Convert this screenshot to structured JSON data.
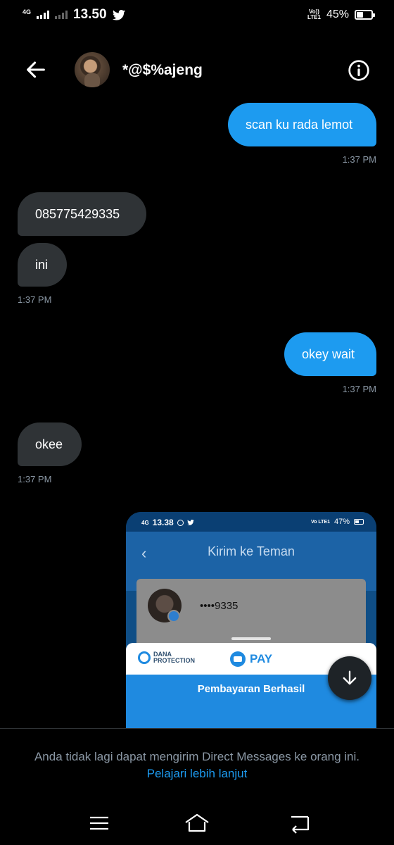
{
  "status_bar": {
    "network": "4G",
    "time": "13.50",
    "volte": [
      "Vo))",
      "LTE1"
    ],
    "battery_percent": "45%",
    "battery_level": 0.45,
    "icons": [
      "signal-icon",
      "twitter-bird-icon",
      "battery-icon"
    ]
  },
  "header": {
    "contact_name": "*@$%ajeng",
    "icons": [
      "back-arrow-icon",
      "info-icon"
    ]
  },
  "messages": [
    {
      "direction": "out",
      "text": "scan ku rada lemot",
      "time": "1:37 PM"
    },
    {
      "direction": "in",
      "text": "085775429335"
    },
    {
      "direction": "in",
      "text": "ini",
      "time": "1:37 PM"
    },
    {
      "direction": "out",
      "text": "okey wait",
      "time": "1:37 PM"
    },
    {
      "direction": "in",
      "text": "okee",
      "time": "1:37 PM"
    }
  ],
  "attachment": {
    "status_network": "4G",
    "status_time": "13.38",
    "status_volte": "Vo LTE1",
    "status_battery": "47%",
    "back_glyph": "‹",
    "title": "Kirim ke Teman",
    "masked_number": "••••9335",
    "protection_label_line1": "DANA",
    "protection_label_line2": "PROTECTION",
    "pay_label": "PAY",
    "success_text": "Pembayaran Berhasil"
  },
  "footer": {
    "note": "Anda tidak lagi dapat mengirim Direct Messages ke orang ini.",
    "link": "Pelajari lebih lanjut"
  },
  "colors": {
    "outgoing_bubble": "#1d9bf0",
    "incoming_bubble": "#2f3336",
    "timestamp": "#8b98a5",
    "link": "#1d9bf0"
  }
}
